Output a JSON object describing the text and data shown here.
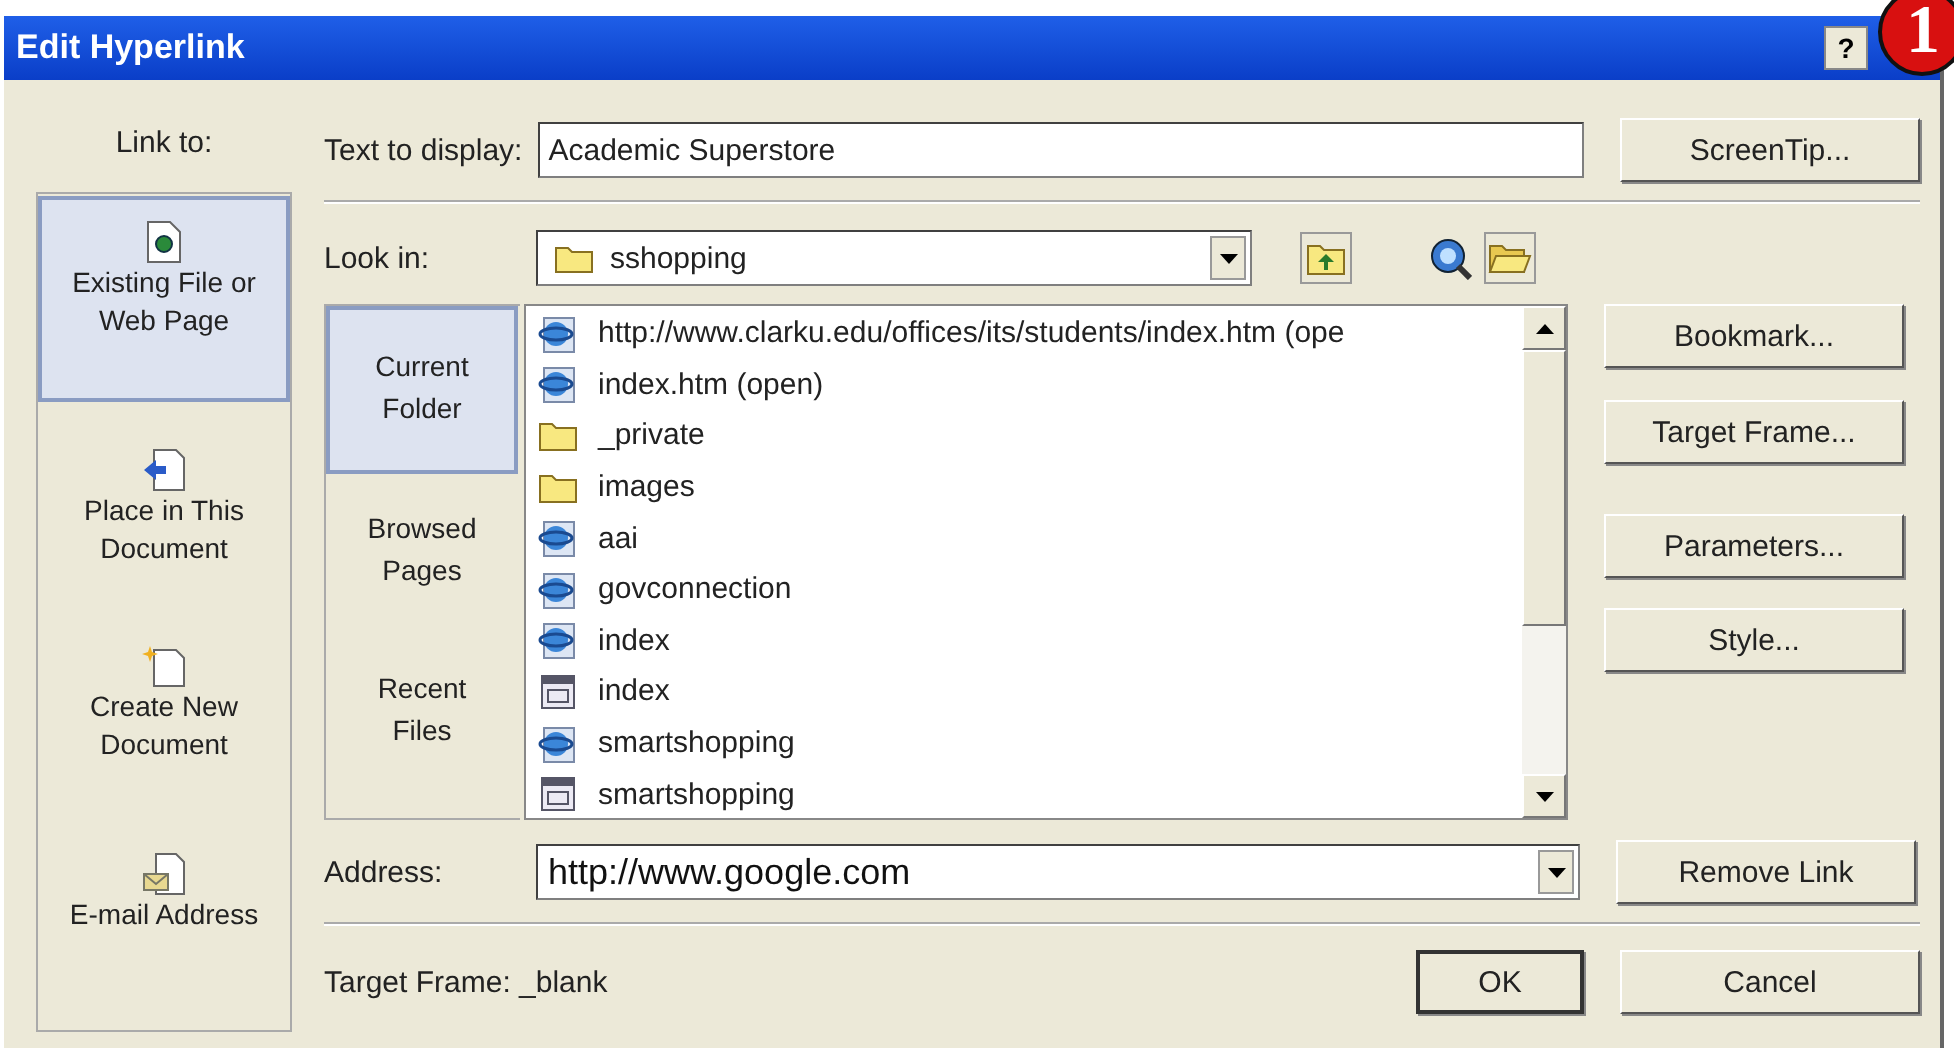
{
  "window": {
    "title": "Edit Hyperlink",
    "help": "?"
  },
  "annotation": {
    "label": "1"
  },
  "link_to": {
    "label": "Link to:",
    "items": [
      {
        "label": "Existing File or Web Page",
        "kind": "file",
        "selected": true
      },
      {
        "label": "Place in This Document",
        "kind": "place",
        "selected": false
      },
      {
        "label": "Create New Document",
        "kind": "new",
        "selected": false
      },
      {
        "label": "E-mail Address",
        "kind": "email",
        "selected": false
      }
    ]
  },
  "text_to_display": {
    "label": "Text to display:",
    "value": "Academic Superstore"
  },
  "look_in": {
    "label": "Look in:",
    "value": "sshopping"
  },
  "browse_tabs": [
    {
      "label": "Current Folder",
      "selected": true
    },
    {
      "label": "Browsed Pages",
      "selected": false
    },
    {
      "label": "Recent Files",
      "selected": false
    }
  ],
  "files": [
    {
      "name": "http://www.clarku.edu/offices/its/students/index.htm (ope",
      "kind": "web"
    },
    {
      "name": "index.htm (open)",
      "kind": "web"
    },
    {
      "name": "_private",
      "kind": "folder"
    },
    {
      "name": "images",
      "kind": "folder"
    },
    {
      "name": "aai",
      "kind": "web"
    },
    {
      "name": "govconnection",
      "kind": "web"
    },
    {
      "name": "index",
      "kind": "web"
    },
    {
      "name": "index",
      "kind": "doc"
    },
    {
      "name": "smartshopping",
      "kind": "web"
    },
    {
      "name": "smartshopping",
      "kind": "doc"
    }
  ],
  "address": {
    "label": "Address:",
    "value": "http://www.google.com"
  },
  "target_frame": {
    "label": "Target Frame: _blank"
  },
  "side_buttons": [
    "ScreenTip...",
    "Bookmark...",
    "Target Frame...",
    "Parameters...",
    "Style...",
    "Remove Link"
  ],
  "buttons": [
    "OK",
    "Cancel"
  ]
}
